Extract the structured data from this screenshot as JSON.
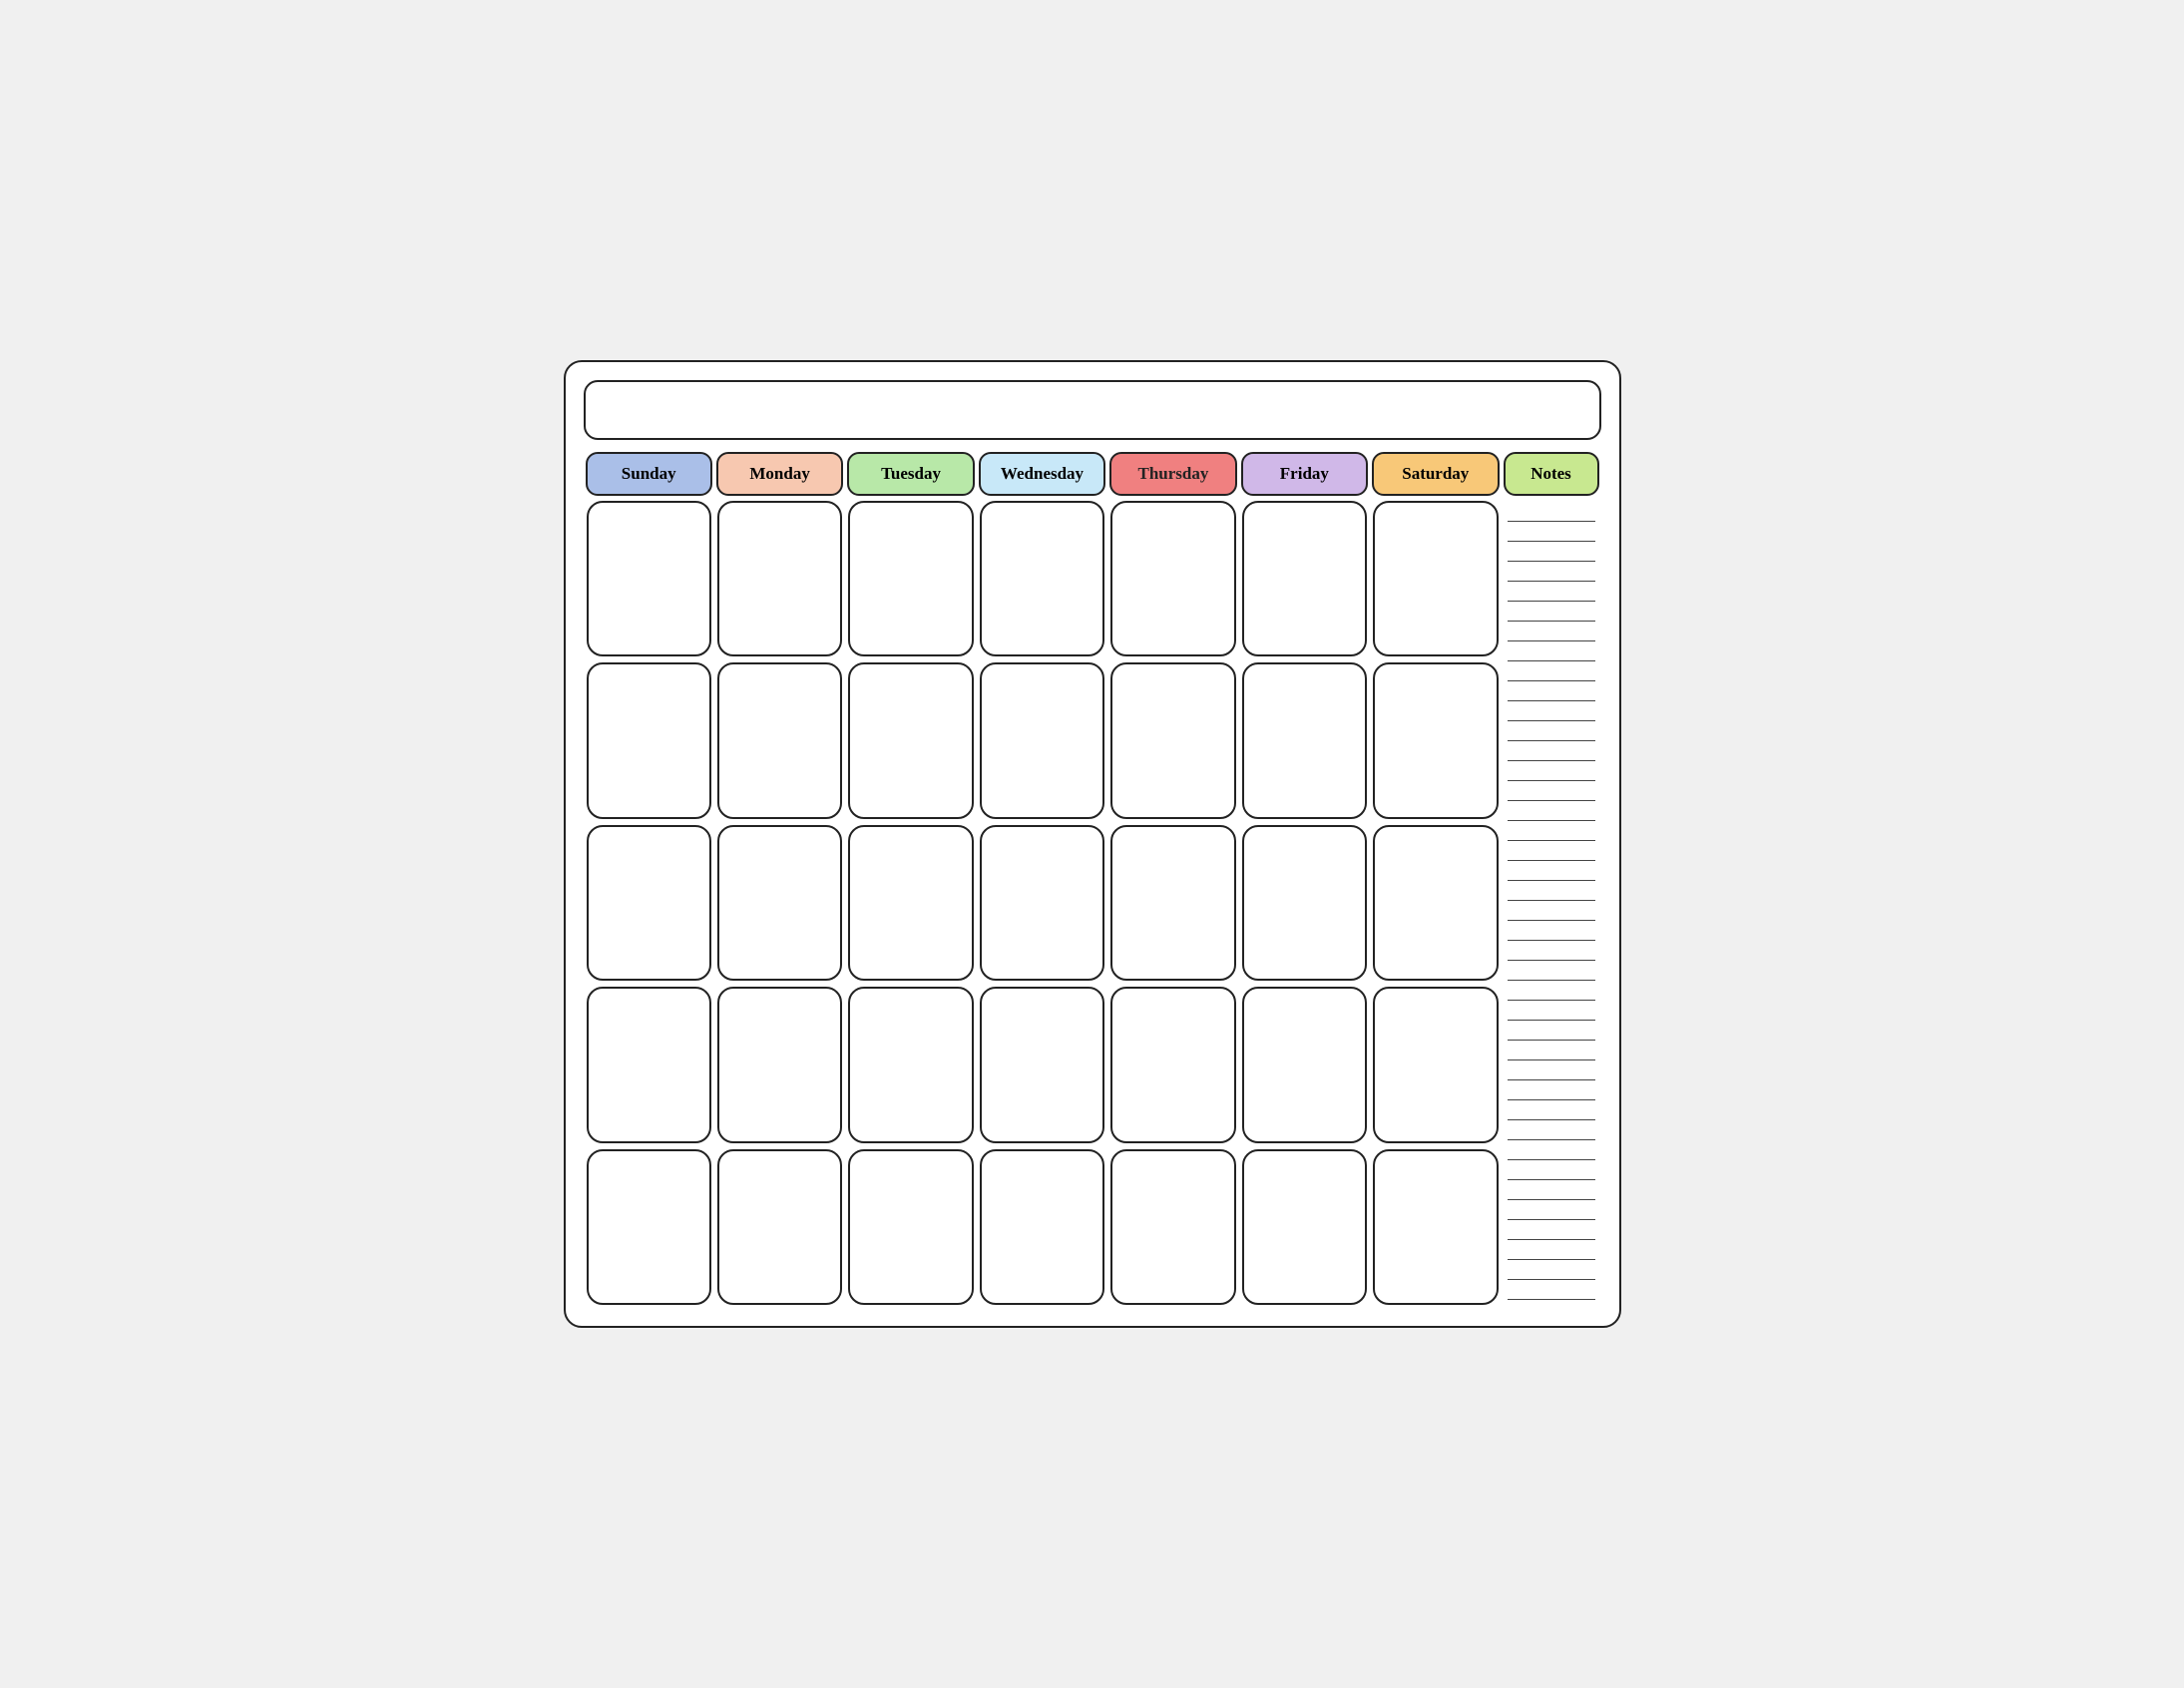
{
  "header": {
    "title": ""
  },
  "days": {
    "headers": [
      "Sunday",
      "Monday",
      "Tuesday",
      "Wednesday",
      "Thursday",
      "Friday",
      "Saturday",
      "Notes"
    ],
    "headerClasses": [
      "header-sunday",
      "header-monday",
      "header-tuesday",
      "header-wednesday",
      "header-thursday",
      "header-friday",
      "header-saturday",
      "header-notes"
    ]
  },
  "rows": 5,
  "cols": 7,
  "notesLines": 40
}
